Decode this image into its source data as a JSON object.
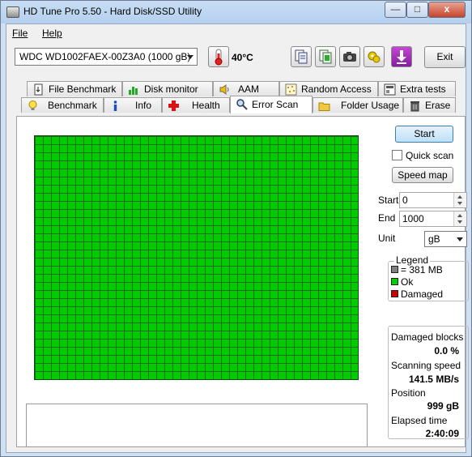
{
  "window": {
    "title": "HD Tune Pro 5.50 - Hard Disk/SSD Utility",
    "min_glyph": "—",
    "max_glyph": "□",
    "close_glyph": "x"
  },
  "menu": {
    "file": "File",
    "help": "Help"
  },
  "toolbar": {
    "drive": "WDC WD1002FAEX-00Z3A0 (1000 gB)",
    "temperature": "40°C",
    "exit_label": "Exit",
    "icons": [
      "copy-text-icon",
      "copy-screenshot-icon",
      "camera-icon",
      "options-icon",
      "save-icon"
    ]
  },
  "tabs": {
    "row1": [
      "File Benchmark",
      "Disk monitor",
      "AAM",
      "Random Access",
      "Extra tests"
    ],
    "row2": [
      "Benchmark",
      "Info",
      "Health",
      "Error Scan",
      "Folder Usage",
      "Erase"
    ],
    "active": "Error Scan"
  },
  "scan": {
    "start_label": "Start",
    "quick_scan_label": "Quick scan",
    "quick_scan_checked": false,
    "speed_map_label": "Speed map",
    "start_field_label": "Start",
    "start_value": "0",
    "end_field_label": "End",
    "end_value": "1000",
    "unit_label": "Unit",
    "unit_value": "gB"
  },
  "legend": {
    "title": "Legend",
    "items": [
      {
        "label": "= 381 MB",
        "color": "#808080"
      },
      {
        "label": "Ok",
        "color": "#00cc00"
      },
      {
        "label": "Damaged",
        "color": "#cc0000"
      }
    ]
  },
  "stats": {
    "damaged_blocks_label": "Damaged blocks",
    "damaged_blocks_value": "0.0 %",
    "scanning_speed_label": "Scanning speed",
    "scanning_speed_value": "141.5 MB/s",
    "position_label": "Position",
    "position_value": "999 gB",
    "elapsed_label": "Elapsed time",
    "elapsed_value": "2:40:09"
  },
  "colors": {
    "ok_block": "#00cc00",
    "grid_line": "#1f6a1f",
    "accent": "#3c7fb1"
  }
}
